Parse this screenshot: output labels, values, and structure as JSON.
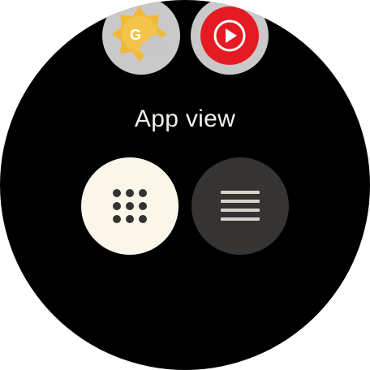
{
  "screen": {
    "title": "App view"
  },
  "apps": [
    {
      "icon": "google-weather-icon",
      "badge_letter": "G"
    },
    {
      "icon": "youtube-music-icon"
    }
  ],
  "options": [
    {
      "icon": "grid-icon",
      "selected": true
    },
    {
      "icon": "list-icon",
      "selected": false
    }
  ],
  "colors": {
    "background": "#000000",
    "title_text": "#f2f0ea",
    "selected_option": "#faf6ea",
    "unselected_option": "#353432",
    "grid_dots": "#35332f",
    "list_lines": "#d6d3cb",
    "app_tile": "#c9c9c9",
    "weather_sun": "#f0b93a",
    "youtube_red": "#e51b23"
  }
}
